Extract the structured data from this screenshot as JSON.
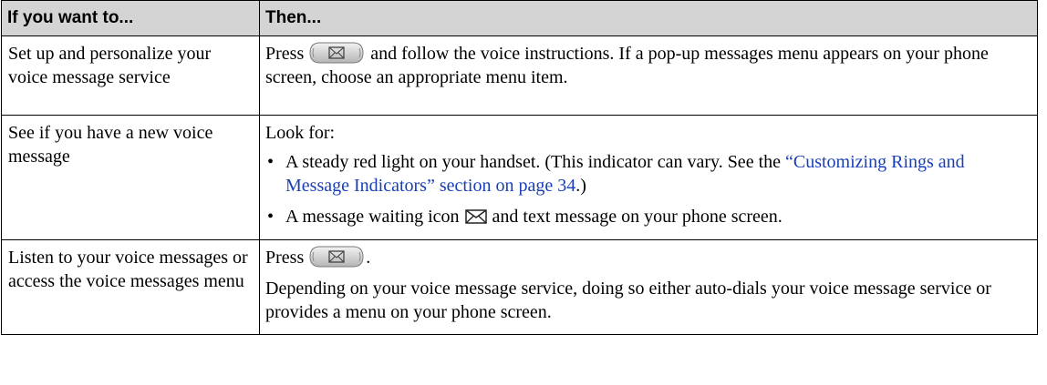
{
  "table": {
    "headers": [
      "If you want to...",
      "Then..."
    ],
    "rows": [
      {
        "task": "Set up and personalize your voice message service",
        "press": "Press",
        "rest": "and follow the voice instructions. If a pop-up messages menu appears on your phone screen, choose an appropriate menu item."
      },
      {
        "task": "See if you have a new voice message",
        "lead": "Look for:",
        "bullet1_pre": "A steady red light on your handset. (This indicator can vary. See the ",
        "bullet1_link": "“Customizing Rings and Message Indicators” section on page 34",
        "bullet1_post": ".)",
        "bullet2_pre": "A message waiting icon",
        "bullet2_post": "and text message on your phone screen."
      },
      {
        "task": "Listen to your voice messages or access the voice messages menu",
        "press": "Press",
        "press_post": ".",
        "detail": "Depending on your voice message service, doing so either auto-dials your voice message service or provides a menu on your phone screen."
      }
    ]
  },
  "icons": {
    "messages_button": "messages-button-icon",
    "message_waiting": "message-waiting-icon"
  },
  "colors": {
    "header_bg": "#d4d4d4",
    "link": "#1a3fb5"
  }
}
